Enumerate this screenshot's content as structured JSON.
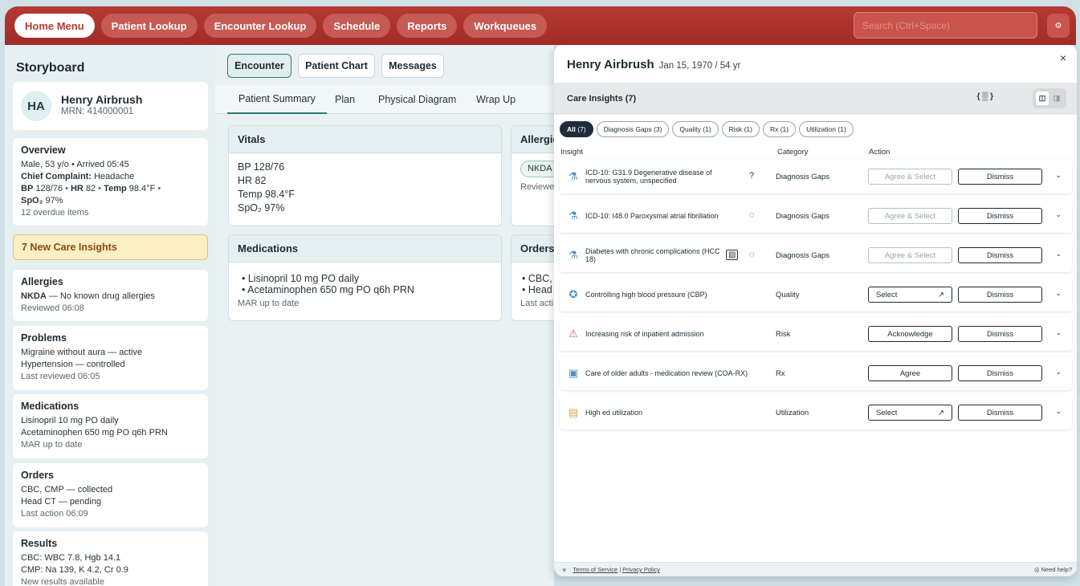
{
  "nav": {
    "items": [
      "Home Menu",
      "Patient Lookup",
      "Encounter Lookup",
      "Schedule",
      "Reports",
      "Workqueues"
    ],
    "active": "Home Menu",
    "search_placeholder": "Search (Ctrl+Space)",
    "settings_icon": "gear-icon"
  },
  "storyboard": {
    "title": "Storyboard",
    "patient": {
      "initials": "HA",
      "name": "Henry Airbrush",
      "mrn": "MRN: 414000001"
    },
    "overview": {
      "title": "Overview",
      "line1": "Male, 53 y/o • Arrived 05:45",
      "cc_label": "Chief Complaint:",
      "cc_value": "Headache",
      "bp_label": "BP",
      "bp_value": "128/76",
      "hr_label": "HR",
      "hr_value": "82",
      "temp_label": "Temp",
      "temp_value": "98.4°F",
      "spo2_label": "SpO₂",
      "spo2_value": "97%",
      "overdue": "12 overdue items"
    },
    "insights_alert": "7 New Care Insights",
    "allergies": {
      "title": "Allergies",
      "nkda": "NKDA",
      "text": "— No known drug allergies",
      "reviewed": "Reviewed 06:08"
    },
    "problems": {
      "title": "Problems",
      "lines": [
        "Migraine without aura — active",
        "Hypertension — controlled"
      ],
      "reviewed": "Last reviewed 06:05"
    },
    "medications": {
      "title": "Medications",
      "lines": [
        "Lisinopril 10 mg PO daily",
        "Acetaminophen 650 mg PO q6h PRN"
      ],
      "status": "MAR up to date"
    },
    "orders": {
      "title": "Orders",
      "lines": [
        "CBC, CMP — collected",
        "Head CT — pending"
      ],
      "status": "Last action 06:09"
    },
    "results": {
      "title": "Results",
      "lines": [
        "CBC: WBC 7.8, Hgb 14.1",
        "CMP: Na 139, K 4.2, Cr 0.9"
      ],
      "status": "New results available"
    }
  },
  "encounter": {
    "subtabs": [
      "Encounter",
      "Patient Chart",
      "Messages"
    ],
    "active_subtab": "Encounter",
    "tabs": [
      "Patient Summary",
      "Plan",
      "Physical Diagram",
      "Wrap Up"
    ],
    "active_tab": "Patient Summary",
    "vitals": {
      "title": "Vitals",
      "lines": [
        "BP 128/76",
        "HR 82",
        "Temp 98.4°F",
        "SpO₂ 97%"
      ]
    },
    "allergies": {
      "title": "Allergie",
      "chip": "NKDA",
      "reviewed": "Reviewe"
    },
    "medications": {
      "title": "Medications",
      "lines": [
        "• Lisinopril 10 mg PO daily",
        "• Acetaminophen 650 mg PO q6h PRN"
      ],
      "status": "MAR up to date"
    },
    "orders": {
      "title": "Orders",
      "lines": [
        "• CBC,",
        "• Head"
      ],
      "status": "Last acti"
    }
  },
  "care_insights": {
    "patient_name": "Henry Airbrush",
    "patient_dob": "Jan 15, 1970  /  54 yr",
    "close": "×",
    "header": "Care Insights (7)",
    "logo": "{ ▒ }",
    "filters": [
      {
        "label": "All",
        "count": "(7)"
      },
      {
        "label": "Diagnosis Gaps",
        "count": "(3)"
      },
      {
        "label": "Quality",
        "count": "(1)"
      },
      {
        "label": "Risk",
        "count": "(1)"
      },
      {
        "label": "Rx",
        "count": "(1)"
      },
      {
        "label": "Utilization",
        "count": "(1)"
      }
    ],
    "columns": {
      "insight": "Insight",
      "category": "Category",
      "action": "Action"
    },
    "rows": [
      {
        "icon": "microscope-icon",
        "text": "ICD-10: G31.9 Degenerative disease of nervous system, unspecified",
        "aux": "?",
        "category": "Diagnosis Gaps",
        "action": "Agree & Select",
        "action_enabled": false,
        "dismiss": "Dismiss"
      },
      {
        "icon": "microscope-icon",
        "text": "ICD-10: I48.0 Paroxysmal atrial fibrillation",
        "aux": "◌",
        "category": "Diagnosis Gaps",
        "action": "Agree & Select",
        "action_enabled": false,
        "dismiss": "Dismiss"
      },
      {
        "icon": "microscope-icon",
        "text": "Diabetes with chronic complications (HCC 18)",
        "aux": "◌",
        "category": "Diagnosis Gaps",
        "action": "Agree & Select",
        "action_enabled": false,
        "dismiss": "Dismiss"
      },
      {
        "icon": "award-icon",
        "text": "Controlling high blood pressure (CBP)",
        "category": "Quality",
        "action": "Select",
        "action_enabled": true,
        "dismiss": "Dismiss"
      },
      {
        "icon": "warning-triangle-icon",
        "text": "Increasing risk of inpatient admission",
        "category": "Risk",
        "action": "Acknowledge",
        "action_enabled": true,
        "dismiss": "Dismiss"
      },
      {
        "icon": "pill-bottle-icon",
        "text": "Care of older adults - medication review (COA-RX)",
        "category": "Rx",
        "action": "Agree",
        "action_enabled": true,
        "dismiss": "Dismiss"
      },
      {
        "icon": "hospital-icon",
        "text": "High ed utilization",
        "category": "Utilization",
        "action": "Select",
        "action_enabled": true,
        "dismiss": "Dismiss"
      }
    ],
    "footer": {
      "terms": "Terms of Service",
      "privacy": "Privacy Policy",
      "help": "Need help?"
    }
  },
  "colors": {
    "nav_bg": "#a22b27",
    "accent_teal": "#2f7a73",
    "insight_alert_bg": "#fcefc4",
    "filter_active": "#1e2c3a"
  }
}
